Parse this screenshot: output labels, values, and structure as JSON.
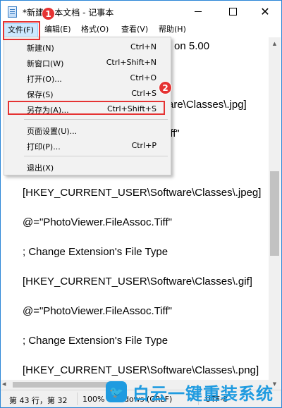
{
  "window": {
    "title": "*新建... 本文档 - 记事本",
    "minimize_symbol": "—",
    "maximize_symbol": "□",
    "close_symbol": "✕"
  },
  "menubar": {
    "file": "文件(F)",
    "edit": "编辑(E)",
    "format": "格式(O)",
    "view": "查看(V)",
    "help": "帮助(H)"
  },
  "file_menu": {
    "items": [
      {
        "label": "新建(N)",
        "shortcut": "Ctrl+N"
      },
      {
        "label": "新窗口(W)",
        "shortcut": "Ctrl+Shift+N"
      },
      {
        "label": "打开(O)...",
        "shortcut": "Ctrl+O"
      },
      {
        "label": "保存(S)",
        "shortcut": "Ctrl+S"
      },
      {
        "label": "另存为(A)...",
        "shortcut": "Ctrl+Shift+S"
      },
      {
        "label": "页面设置(U)...",
        "shortcut": ""
      },
      {
        "label": "打印(P)...",
        "shortcut": "Ctrl+P"
      },
      {
        "label": "退出(X)",
        "shortcut": ""
      }
    ]
  },
  "annotations": {
    "step1": "1",
    "step2": "2",
    "highlight_color": "#e53333"
  },
  "editor": {
    "lines": [
      "on 5.00",
      "are\\Classes\\.jpg]",
      "iff\"",
      "[HKEY_CURRENT_USER\\Software\\Classes\\.jpeg]",
      "@=\"PhotoViewer.FileAssoc.Tiff\"",
      "; Change Extension's File Type",
      "[HKEY_CURRENT_USER\\Software\\Classes\\.gif]",
      "@=\"PhotoViewer.FileAssoc.Tiff\"",
      "; Change Extension's File Type",
      "[HKEY_CURRENT_USER\\Software\\Classes\\.png]"
    ]
  },
  "statusbar": {
    "position": "第 43 行，第 32",
    "zoom": "100%",
    "line_ending": "ndows (CRLF)",
    "encoding": "UTF-8"
  },
  "watermark": {
    "text": "白云一键重装系统",
    "icon": "bird-icon",
    "color": "#1f9be0"
  }
}
